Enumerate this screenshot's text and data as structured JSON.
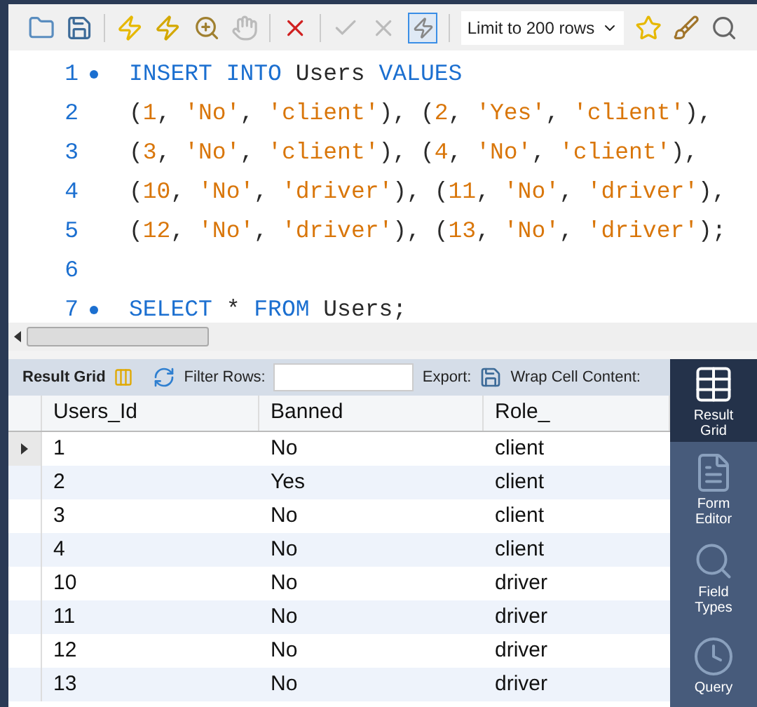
{
  "toolbar": {
    "limit_select": "Limit to 200 rows"
  },
  "editor": {
    "lines": [
      {
        "number": "1",
        "marker": true,
        "tokens": [
          {
            "kind": "keyword",
            "text": "INSERT INTO"
          },
          {
            "kind": "plain",
            "text": " Users "
          },
          {
            "kind": "keyword",
            "text": "VALUES"
          }
        ]
      },
      {
        "number": "2",
        "marker": false,
        "tokens": [
          {
            "kind": "plain",
            "text": "("
          },
          {
            "kind": "value",
            "text": "1"
          },
          {
            "kind": "plain",
            "text": ", "
          },
          {
            "kind": "value",
            "text": "'No'"
          },
          {
            "kind": "plain",
            "text": ", "
          },
          {
            "kind": "value",
            "text": "'client'"
          },
          {
            "kind": "plain",
            "text": "), ("
          },
          {
            "kind": "value",
            "text": "2"
          },
          {
            "kind": "plain",
            "text": ", "
          },
          {
            "kind": "value",
            "text": "'Yes'"
          },
          {
            "kind": "plain",
            "text": ", "
          },
          {
            "kind": "value",
            "text": "'client'"
          },
          {
            "kind": "plain",
            "text": "),"
          }
        ]
      },
      {
        "number": "3",
        "marker": false,
        "tokens": [
          {
            "kind": "plain",
            "text": "("
          },
          {
            "kind": "value",
            "text": "3"
          },
          {
            "kind": "plain",
            "text": ", "
          },
          {
            "kind": "value",
            "text": "'No'"
          },
          {
            "kind": "plain",
            "text": ", "
          },
          {
            "kind": "value",
            "text": "'client'"
          },
          {
            "kind": "plain",
            "text": "), ("
          },
          {
            "kind": "value",
            "text": "4"
          },
          {
            "kind": "plain",
            "text": ", "
          },
          {
            "kind": "value",
            "text": "'No'"
          },
          {
            "kind": "plain",
            "text": ", "
          },
          {
            "kind": "value",
            "text": "'client'"
          },
          {
            "kind": "plain",
            "text": "),"
          }
        ]
      },
      {
        "number": "4",
        "marker": false,
        "tokens": [
          {
            "kind": "plain",
            "text": "("
          },
          {
            "kind": "value",
            "text": "10"
          },
          {
            "kind": "plain",
            "text": ", "
          },
          {
            "kind": "value",
            "text": "'No'"
          },
          {
            "kind": "plain",
            "text": ", "
          },
          {
            "kind": "value",
            "text": "'driver'"
          },
          {
            "kind": "plain",
            "text": "), ("
          },
          {
            "kind": "value",
            "text": "11"
          },
          {
            "kind": "plain",
            "text": ", "
          },
          {
            "kind": "value",
            "text": "'No'"
          },
          {
            "kind": "plain",
            "text": ", "
          },
          {
            "kind": "value",
            "text": "'driver'"
          },
          {
            "kind": "plain",
            "text": "),"
          }
        ]
      },
      {
        "number": "5",
        "marker": false,
        "tokens": [
          {
            "kind": "plain",
            "text": "("
          },
          {
            "kind": "value",
            "text": "12"
          },
          {
            "kind": "plain",
            "text": ", "
          },
          {
            "kind": "value",
            "text": "'No'"
          },
          {
            "kind": "plain",
            "text": ", "
          },
          {
            "kind": "value",
            "text": "'driver'"
          },
          {
            "kind": "plain",
            "text": "), ("
          },
          {
            "kind": "value",
            "text": "13"
          },
          {
            "kind": "plain",
            "text": ", "
          },
          {
            "kind": "value",
            "text": "'No'"
          },
          {
            "kind": "plain",
            "text": ", "
          },
          {
            "kind": "value",
            "text": "'driver'"
          },
          {
            "kind": "plain",
            "text": ");"
          }
        ]
      },
      {
        "number": "6",
        "marker": false
      },
      {
        "number": "7",
        "marker": true,
        "tokens": [
          {
            "kind": "keyword",
            "text": "SELECT"
          },
          {
            "kind": "plain",
            "text": " * "
          },
          {
            "kind": "keyword",
            "text": "FROM"
          },
          {
            "kind": "plain",
            "text": " Users;"
          }
        ]
      }
    ]
  },
  "result_toolbar": {
    "result_grid_label": "Result Grid",
    "filter_label": "Filter Rows:",
    "export_label": "Export:",
    "wrap_label": "Wrap Cell Content:"
  },
  "table": {
    "columns": [
      "Users_Id",
      "Banned",
      "Role_"
    ],
    "rows": [
      {
        "cells": [
          "1",
          "No",
          "client"
        ],
        "selected": true
      },
      {
        "cells": [
          "2",
          "Yes",
          "client"
        ],
        "selected": false
      },
      {
        "cells": [
          "3",
          "No",
          "client"
        ],
        "selected": false
      },
      {
        "cells": [
          "4",
          "No",
          "client"
        ],
        "selected": false
      },
      {
        "cells": [
          "10",
          "No",
          "driver"
        ],
        "selected": false
      },
      {
        "cells": [
          "11",
          "No",
          "driver"
        ],
        "selected": false
      },
      {
        "cells": [
          "12",
          "No",
          "driver"
        ],
        "selected": false
      },
      {
        "cells": [
          "13",
          "No",
          "driver"
        ],
        "selected": false
      }
    ]
  },
  "side_panel": [
    {
      "label": "Result Grid",
      "kind": "grid",
      "selected": true
    },
    {
      "label": "Form Editor",
      "kind": "form",
      "selected": false
    },
    {
      "label": "Field Types",
      "kind": "fields",
      "selected": false
    },
    {
      "label": "Query",
      "kind": "query",
      "selected": false
    }
  ]
}
